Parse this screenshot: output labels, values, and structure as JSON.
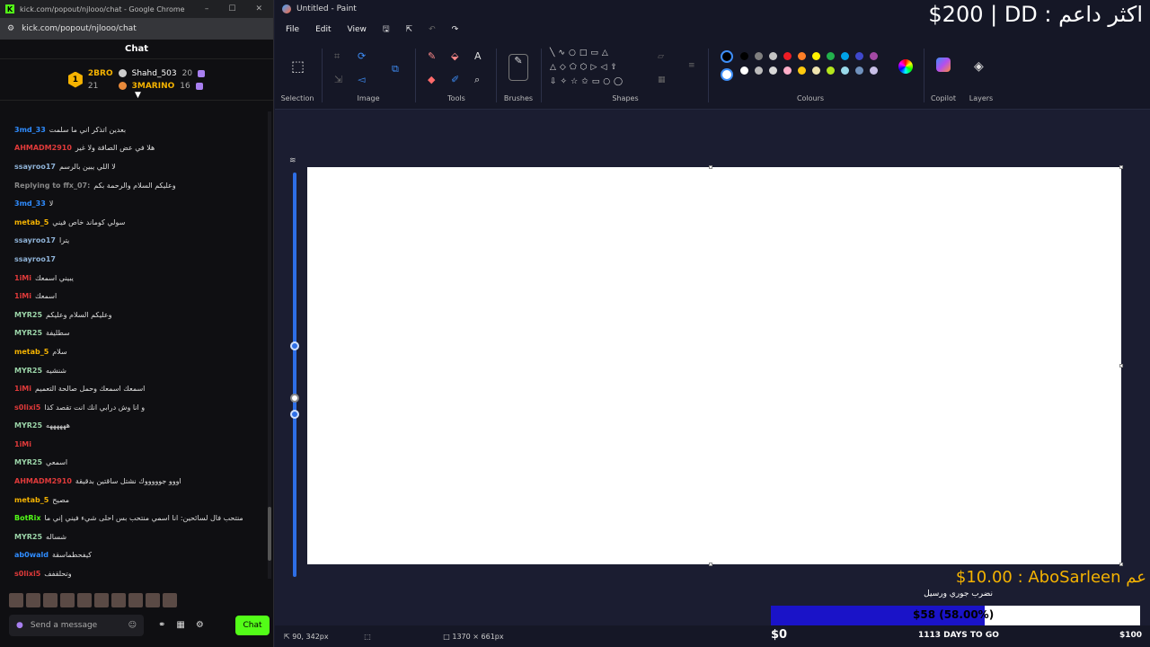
{
  "chrome": {
    "title": "kick.com/popout/njlooo/chat - Google Chrome",
    "url": "kick.com/popout/njlooo/chat"
  },
  "chat": {
    "header": "Chat",
    "leaderboard": {
      "rank": "1",
      "first": {
        "name": "2BRO",
        "points": "21"
      },
      "second": {
        "name": "Shahd_503",
        "points": "20"
      },
      "third": {
        "name": "3MARINO",
        "points": "16"
      }
    },
    "messages": [
      {
        "user": "3md_33",
        "color": "#2f8cff",
        "text": "بعدين اتذكر اني ما سلمت"
      },
      {
        "user": "AHMADM2910",
        "color": "#e03a3a",
        "text": "هلا في عض الصاقة ولا غير"
      },
      {
        "user": "ssayroo17",
        "color": "#8fb3d8",
        "text": "لا اللي يبين بالرسم"
      },
      {
        "user": "Replying to ffx_07:",
        "color": "#888888",
        "text": "وعليكم السلام والرحمة بكم"
      },
      {
        "user": "3md_33",
        "color": "#2f8cff",
        "text": "لا"
      },
      {
        "user": "metab_5",
        "color": "#f5b301",
        "text": "سولي كوماند خاص فيني"
      },
      {
        "user": "ssayroo17",
        "color": "#8fb3d8",
        "text": "يترا"
      },
      {
        "user": "ssayroo17",
        "color": "#8fb3d8",
        "text": ""
      },
      {
        "user": "1iMi",
        "color": "#e03a3a",
        "text": "يبيني اسمعك"
      },
      {
        "user": "1iMi",
        "color": "#e03a3a",
        "text": "اسمعك"
      },
      {
        "user": "MYR25",
        "color": "#9bd4a8",
        "text": "وعليكم السلام وعليكم"
      },
      {
        "user": "MYR25",
        "color": "#9bd4a8",
        "text": "سطليفة"
      },
      {
        "user": "metab_5",
        "color": "#f5b301",
        "text": "سلام"
      },
      {
        "user": "MYR25",
        "color": "#9bd4a8",
        "text": "شنشيه"
      },
      {
        "user": "1iMi",
        "color": "#e03a3a",
        "text": "اسمعك اسمعك وحمل صالحة التعميم"
      },
      {
        "user": "s0lixi5",
        "color": "#e03a3a",
        "text": "و انا وش درابي انك انت تقصد كذا"
      },
      {
        "user": "MYR25",
        "color": "#9bd4a8",
        "text": "ههههههه"
      },
      {
        "user": "1iMi",
        "color": "#e03a3a",
        "text": ""
      },
      {
        "user": "MYR25",
        "color": "#9bd4a8",
        "text": "اسمعي"
      },
      {
        "user": "AHMADM2910",
        "color": "#e03a3a",
        "text": "اووو جوووووك نشتل ساقتين بدقيقة"
      },
      {
        "user": "metab_5",
        "color": "#f5b301",
        "text": "مصيح"
      },
      {
        "user": "BotRix",
        "color": "#53fc18",
        "text": "منتحب فال لسائحين: انا اسمي منتحب بس احلى شيء فيني إني ما"
      },
      {
        "user": "MYR25",
        "color": "#9bd4a8",
        "text": "شساله"
      },
      {
        "user": "ab0wald",
        "color": "#2f8cff",
        "text": "كيفحطماسقة"
      },
      {
        "user": "s0lixi5",
        "color": "#e03a3a",
        "text": "وتحلقفف"
      }
    ],
    "compose_placeholder": "Send a message",
    "chat_button": "Chat"
  },
  "paint": {
    "title": "Untitled - Paint",
    "menu": [
      "File",
      "Edit",
      "View"
    ],
    "groups": [
      "Selection",
      "Image",
      "Tools",
      "Brushes",
      "Shapes",
      "Colours",
      "Copilot",
      "Layers"
    ],
    "palette": [
      "#000000",
      "#7f7f7f",
      "#c3c3c3",
      "#ed1c24",
      "#ff7f27",
      "#fff200",
      "#22b14c",
      "#00a2e8",
      "#3f48cc",
      "#a349a4",
      "#ffffff",
      "#bcbcbc",
      "#d8d8d8",
      "#ffaec9",
      "#ffc90e",
      "#efe4b0",
      "#b5e61d",
      "#99d9ea",
      "#7092be",
      "#c8bfe7"
    ],
    "status": {
      "cursor": "90, 342px",
      "size": "1370 × 661px"
    }
  },
  "overlay": {
    "top_text": "$200 | DD : اكثر داعم",
    "donation": "$10.00 : AboSarleen عم",
    "donation_msg": "نضرب جوري ورسيل",
    "goal": {
      "fraction": 0.58,
      "label": "$58 (58.00%)",
      "start": "$0",
      "days": "1113 DAYS TO GO",
      "end": "$100"
    }
  }
}
